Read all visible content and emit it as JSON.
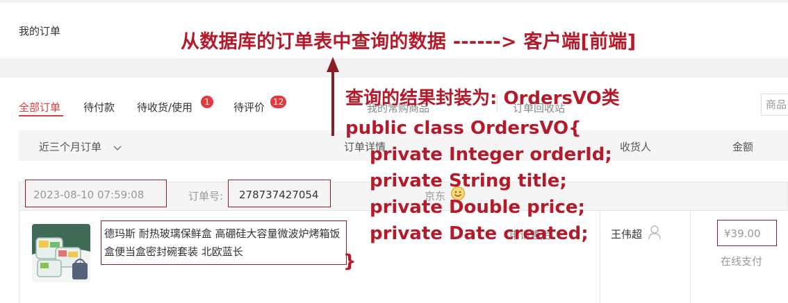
{
  "page": {
    "title": "我的订单"
  },
  "annotations": {
    "main": "从数据库的订单表中查询的数据 ------>  客户端[前端]",
    "result_line": "查询的结果封装为: OrdersVO类",
    "code": [
      "public class OrdersVO{",
      "private Integer orderId;",
      "private String title;",
      "private Double price;",
      "private Date  created;",
      "}"
    ]
  },
  "tabs": [
    {
      "label": "全部订单",
      "active": true
    },
    {
      "label": "待付款"
    },
    {
      "label": "待收货/使用",
      "badge": "1"
    },
    {
      "label": "待评价",
      "badge": "12"
    }
  ],
  "ghost_tabs": {
    "my_used": "我的常购商品",
    "recycle": "订单回收站"
  },
  "search": {
    "placeholder": "商品"
  },
  "table_header": {
    "filter_label": "近三个月订单",
    "order_detail": "订单详情",
    "consignee": "收货人",
    "amount": "金额"
  },
  "order": {
    "datetime": "2023-08-10 07:59:08",
    "number_label": "订单号:",
    "number": "278737427054",
    "shop": "京东",
    "title": "德玛斯 耐热玻璃保鲜盒 高硼硅大容量微波炉烤箱饭盒便当盒密封碗套装 北欧蓝长",
    "service_ghost": "申请售后",
    "consignee": "王伟超",
    "price": "¥39.00",
    "payment": "在线支付"
  },
  "colors": {
    "accent": "#e4393c",
    "annotation": "#b41a2a",
    "box": "#8b1c28"
  },
  "icons": [
    "chevron-down-icon",
    "user-icon",
    "smile-icon",
    "arrow-up-icon"
  ]
}
